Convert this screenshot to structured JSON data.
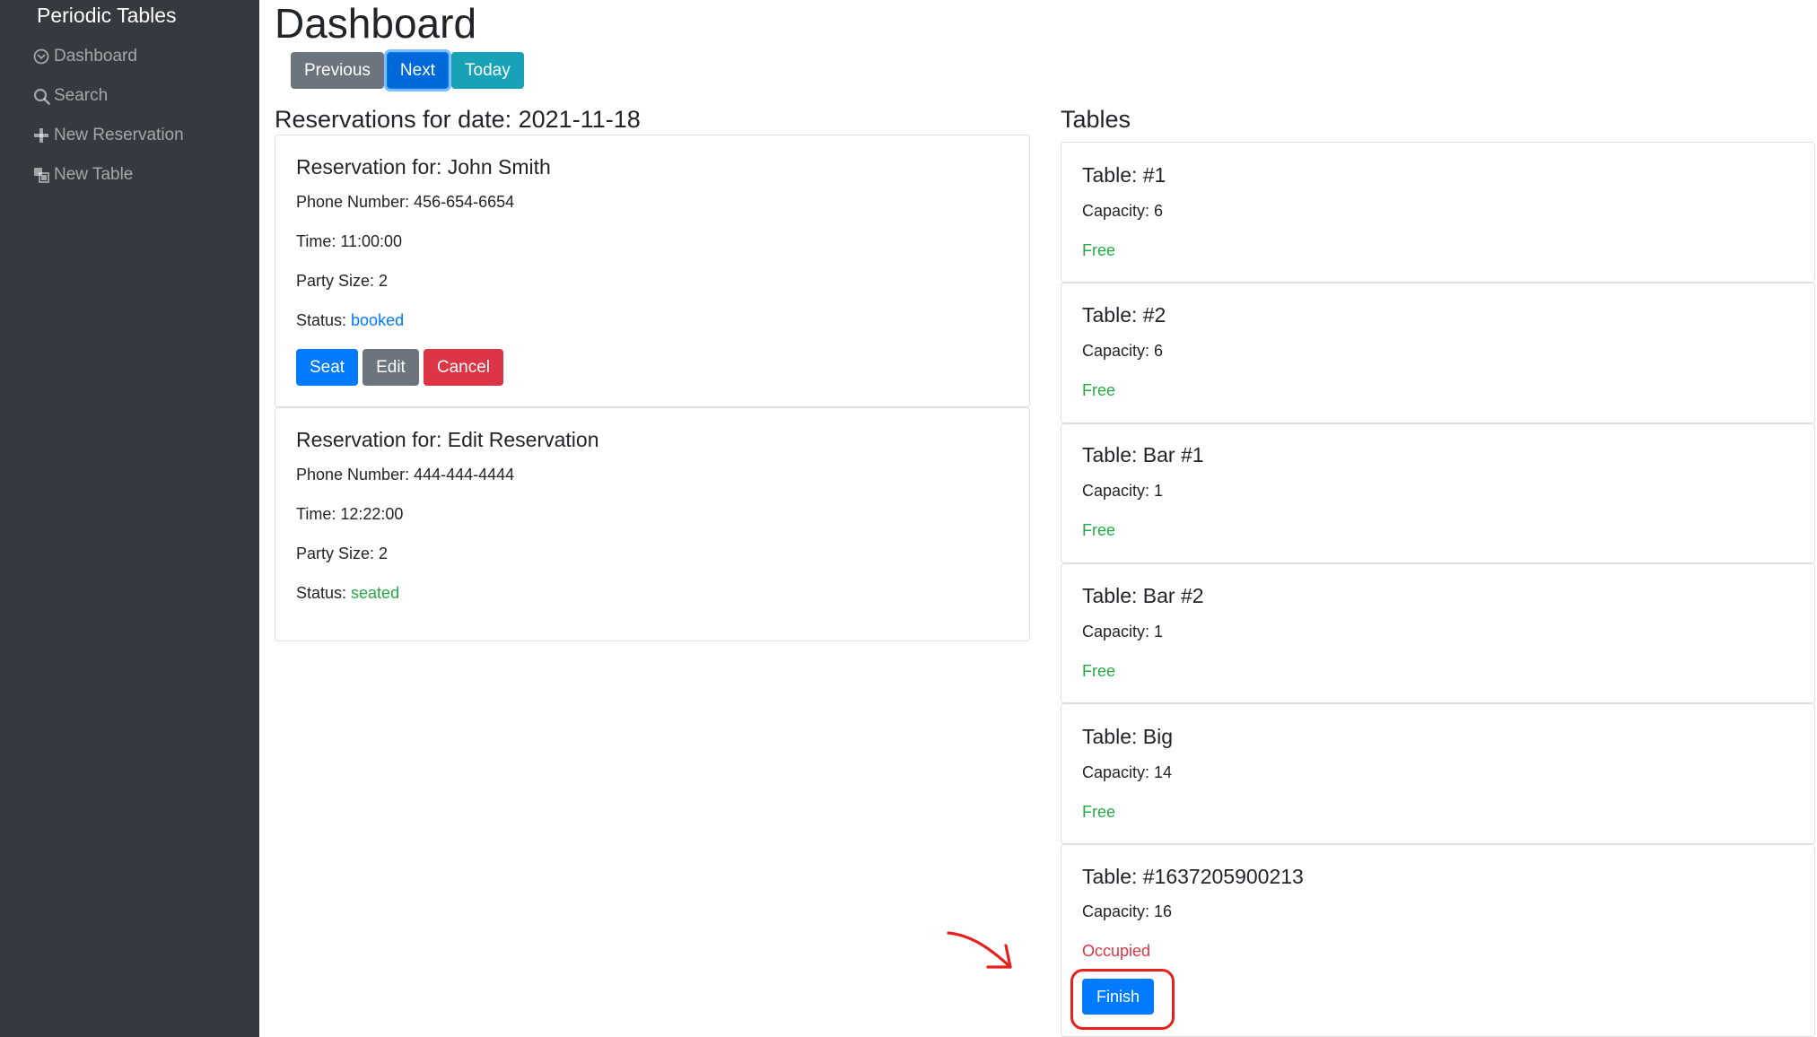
{
  "sidebar": {
    "brand": "Periodic Tables",
    "items": [
      {
        "label": "Dashboard",
        "icon": "dashboard-icon"
      },
      {
        "label": "Search",
        "icon": "search-icon"
      },
      {
        "label": "New Reservation",
        "icon": "plus-icon"
      },
      {
        "label": "New Table",
        "icon": "layers-icon"
      }
    ]
  },
  "header": {
    "title": "Dashboard",
    "buttons": {
      "previous": "Previous",
      "next": "Next",
      "today": "Today"
    }
  },
  "reservations": {
    "heading": "Reservations for date: 2021-11-18",
    "items": [
      {
        "title": "Reservation for: John Smith",
        "phone": "Phone Number: 456-654-6654",
        "time": "Time: 11:00:00",
        "party": "Party Size: 2",
        "status_label": "Status: ",
        "status": "booked",
        "actions": {
          "seat": "Seat",
          "edit": "Edit",
          "cancel": "Cancel"
        }
      },
      {
        "title": "Reservation for: Edit Reservation",
        "phone": "Phone Number: 444-444-4444",
        "time": "Time: 12:22:00",
        "party": "Party Size: 2",
        "status_label": "Status: ",
        "status": "seated"
      }
    ]
  },
  "tables": {
    "heading": "Tables",
    "items": [
      {
        "title": "Table: #1",
        "capacity": "Capacity: 6",
        "status": "Free"
      },
      {
        "title": "Table: #2",
        "capacity": "Capacity: 6",
        "status": "Free"
      },
      {
        "title": "Table: Bar #1",
        "capacity": "Capacity: 1",
        "status": "Free"
      },
      {
        "title": "Table: Bar #2",
        "capacity": "Capacity: 1",
        "status": "Free"
      },
      {
        "title": "Table: Big",
        "capacity": "Capacity: 14",
        "status": "Free"
      },
      {
        "title": "Table: #1637205900213",
        "capacity": "Capacity: 16",
        "status": "Occupied",
        "action": "Finish"
      }
    ]
  },
  "colors": {
    "sidebar_bg": "#343a40",
    "primary": "#007bff",
    "secondary": "#6c757d",
    "info": "#17a2b8",
    "danger": "#dc3545",
    "success": "#28a745",
    "annotation": "#e8201b"
  }
}
